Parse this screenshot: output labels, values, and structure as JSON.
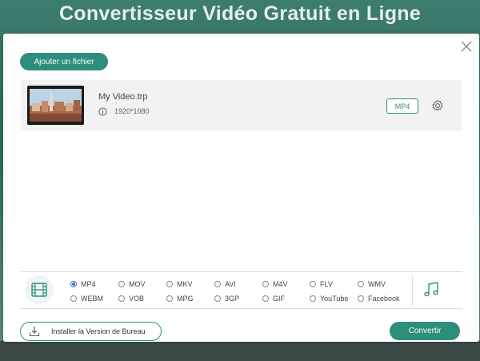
{
  "background": {
    "title": "Convertisseur Vidéo Gratuit en Ligne"
  },
  "dialog": {
    "add_file_label": "Ajouter un fichier",
    "file": {
      "name": "My Video.trp",
      "resolution": "1920*1080",
      "format": "MP4"
    },
    "formats": [
      {
        "label": "MP4",
        "checked": true
      },
      {
        "label": "MOV",
        "checked": false
      },
      {
        "label": "MKV",
        "checked": false
      },
      {
        "label": "AVI",
        "checked": false
      },
      {
        "label": "M4V",
        "checked": false
      },
      {
        "label": "FLV",
        "checked": false
      },
      {
        "label": "WMV",
        "checked": false
      },
      {
        "label": "WEBM",
        "checked": false
      },
      {
        "label": "VOB",
        "checked": false
      },
      {
        "label": "MPG",
        "checked": false
      },
      {
        "label": "3GP",
        "checked": false
      },
      {
        "label": "GIF",
        "checked": false
      },
      {
        "label": "YouTube",
        "checked": false
      },
      {
        "label": "Facebook",
        "checked": false
      }
    ],
    "install_label": "Installer la Version de Bureau",
    "convert_label": "Convertir"
  },
  "colors": {
    "accent": "#2e8e7c",
    "radio_checked": "#3f6fd0"
  },
  "icons": {
    "close": "close-icon",
    "info": "info-icon",
    "settings": "gear-icon",
    "video": "film-icon",
    "audio": "music-note-icon",
    "download": "download-icon"
  }
}
